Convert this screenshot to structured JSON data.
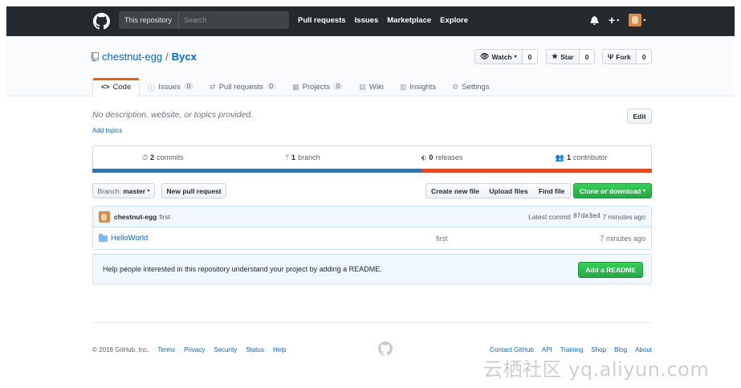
{
  "header": {
    "search_scope": "This repository",
    "search_placeholder": "Search",
    "nav": [
      "Pull requests",
      "Issues",
      "Marketplace",
      "Explore"
    ],
    "plus_label": "+",
    "caret": "▾"
  },
  "repo": {
    "owner": "chestnut-egg",
    "separator": "/",
    "name": "Bycx",
    "watch": {
      "label": "Watch",
      "count": "0"
    },
    "star": {
      "label": "Star",
      "count": "0"
    },
    "fork": {
      "label": "Fork",
      "count": "0"
    }
  },
  "tabs": [
    {
      "label": "Code",
      "icon": "<>",
      "count": null
    },
    {
      "label": "Issues",
      "icon": "ⓘ",
      "count": "0"
    },
    {
      "label": "Pull requests",
      "icon": "⇄",
      "count": "0"
    },
    {
      "label": "Projects",
      "icon": "▦",
      "count": "0"
    },
    {
      "label": "Wiki",
      "icon": "▤",
      "count": null
    },
    {
      "label": "Insights",
      "icon": "▥",
      "count": null
    },
    {
      "label": "Settings",
      "icon": "⚙",
      "count": null
    }
  ],
  "description": {
    "text": "No description, website, or topics provided.",
    "add_topics": "Add topics",
    "edit": "Edit"
  },
  "summary": {
    "commits": {
      "count": "2",
      "label": "commits"
    },
    "branches": {
      "count": "1",
      "label": "branch"
    },
    "releases": {
      "count": "0",
      "label": "releases"
    },
    "contributors": {
      "count": "1",
      "label": "contributor"
    }
  },
  "language_colors": {
    "primary": "#3572a5",
    "secondary": "#e34c26"
  },
  "language_share": {
    "primary": 0.59,
    "secondary": 0.41
  },
  "file_nav": {
    "branch_label": "Branch:",
    "branch": "master",
    "new_pull_request": "New pull request",
    "create_new_file": "Create new file",
    "upload_files": "Upload files",
    "find_file": "Find file",
    "clone": "Clone or download"
  },
  "commit_tease": {
    "author": "chestnut-egg",
    "message": "first",
    "latest_label": "Latest commit",
    "sha": "87da3ed",
    "age": "7 minutes ago"
  },
  "files": [
    {
      "name": "HelloWorld",
      "message": "first",
      "age": "7 minutes ago"
    }
  ],
  "readme_banner": {
    "text": "Help people interested in this repository understand your project by adding a README.",
    "button": "Add a README"
  },
  "footer": {
    "copyright": "© 2018 GitHub, Inc.",
    "left_links": [
      "Terms",
      "Privacy",
      "Security",
      "Status",
      "Help"
    ],
    "right_links": [
      "Contact GitHub",
      "API",
      "Training",
      "Shop",
      "Blog",
      "About"
    ]
  },
  "watermark": "云栖社区 yq.aliyun.com"
}
